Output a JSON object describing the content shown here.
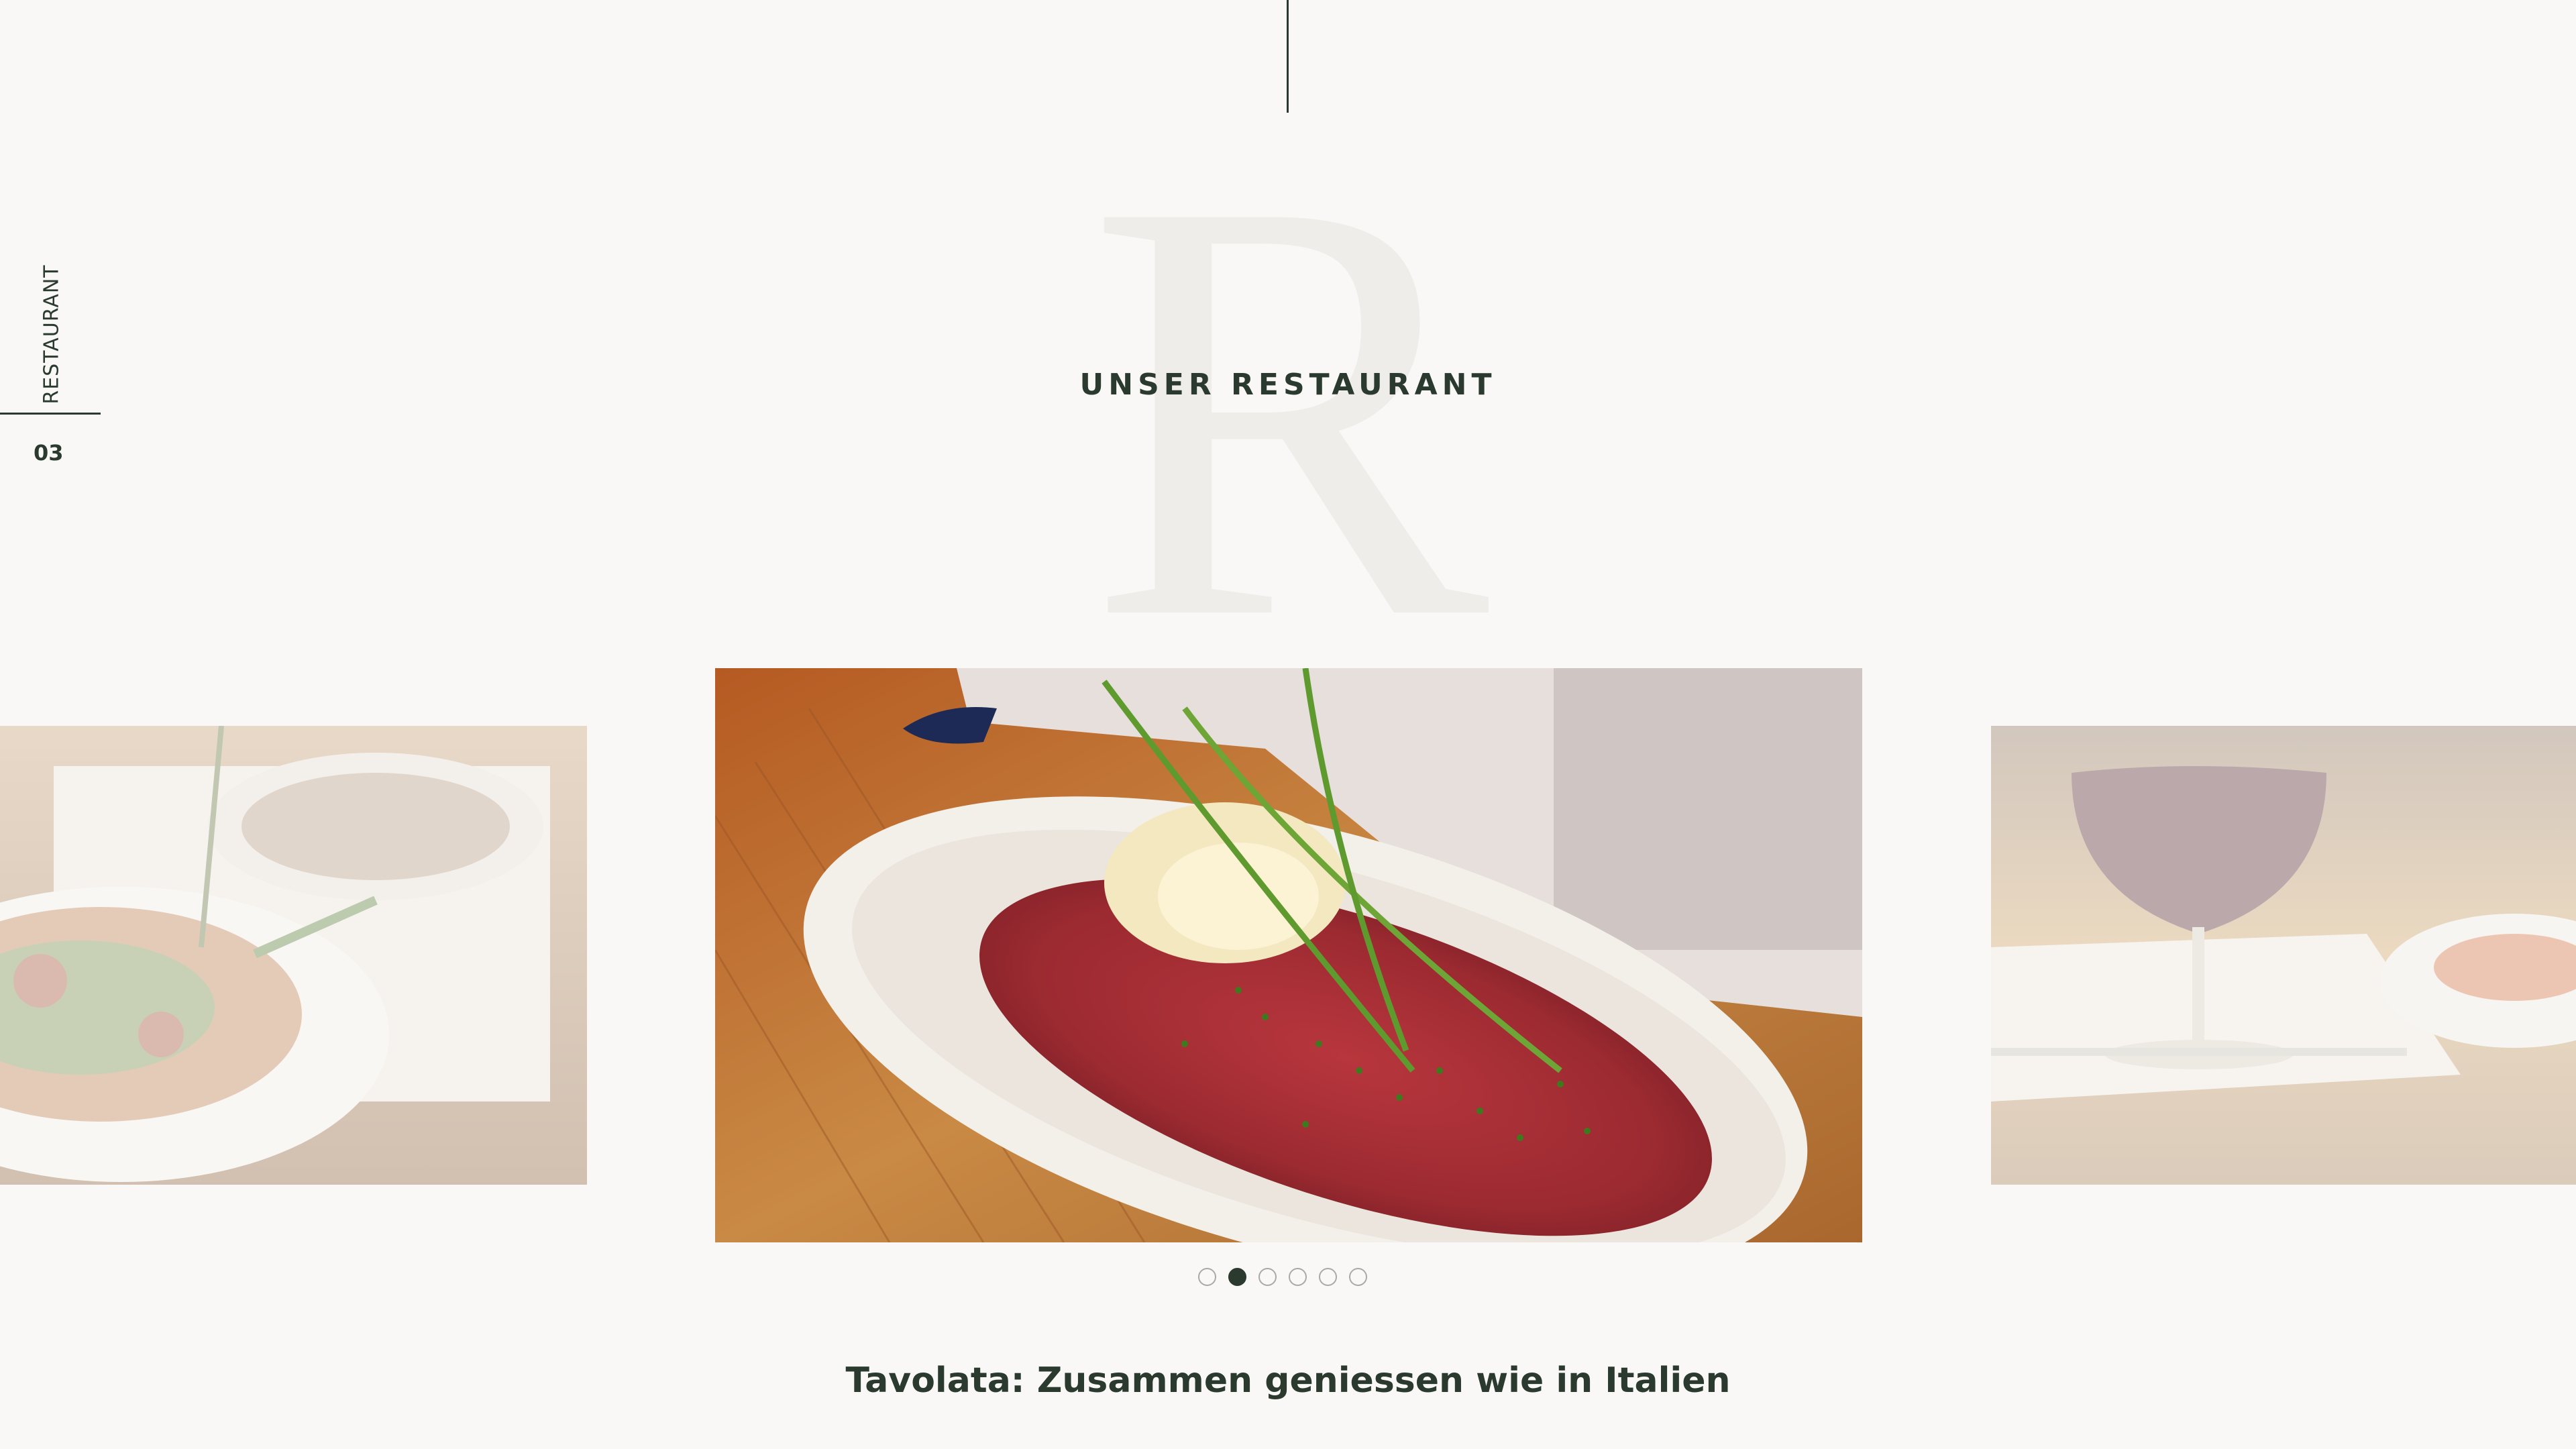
{
  "section": {
    "side_label": "RESTAURANT",
    "number": "03",
    "decor_letter": "R",
    "heading": "UNSER RESTAURANT"
  },
  "carousel": {
    "slides": [
      {
        "id": "slide-prev",
        "description_icon": "octopus-salad-image"
      },
      {
        "id": "slide-active",
        "description_icon": "carpaccio-image"
      },
      {
        "id": "slide-next",
        "description_icon": "red-wine-image"
      }
    ],
    "dot_count": 6,
    "active_dot_index": 1
  },
  "headline": "Tavolata: Zusammen geniessen wie in Italien",
  "colors": {
    "background": "#f9f8f6",
    "text": "#2a3a2e",
    "decor_letter": "#efedea",
    "dot_inactive_border": "#a9aaa6"
  }
}
